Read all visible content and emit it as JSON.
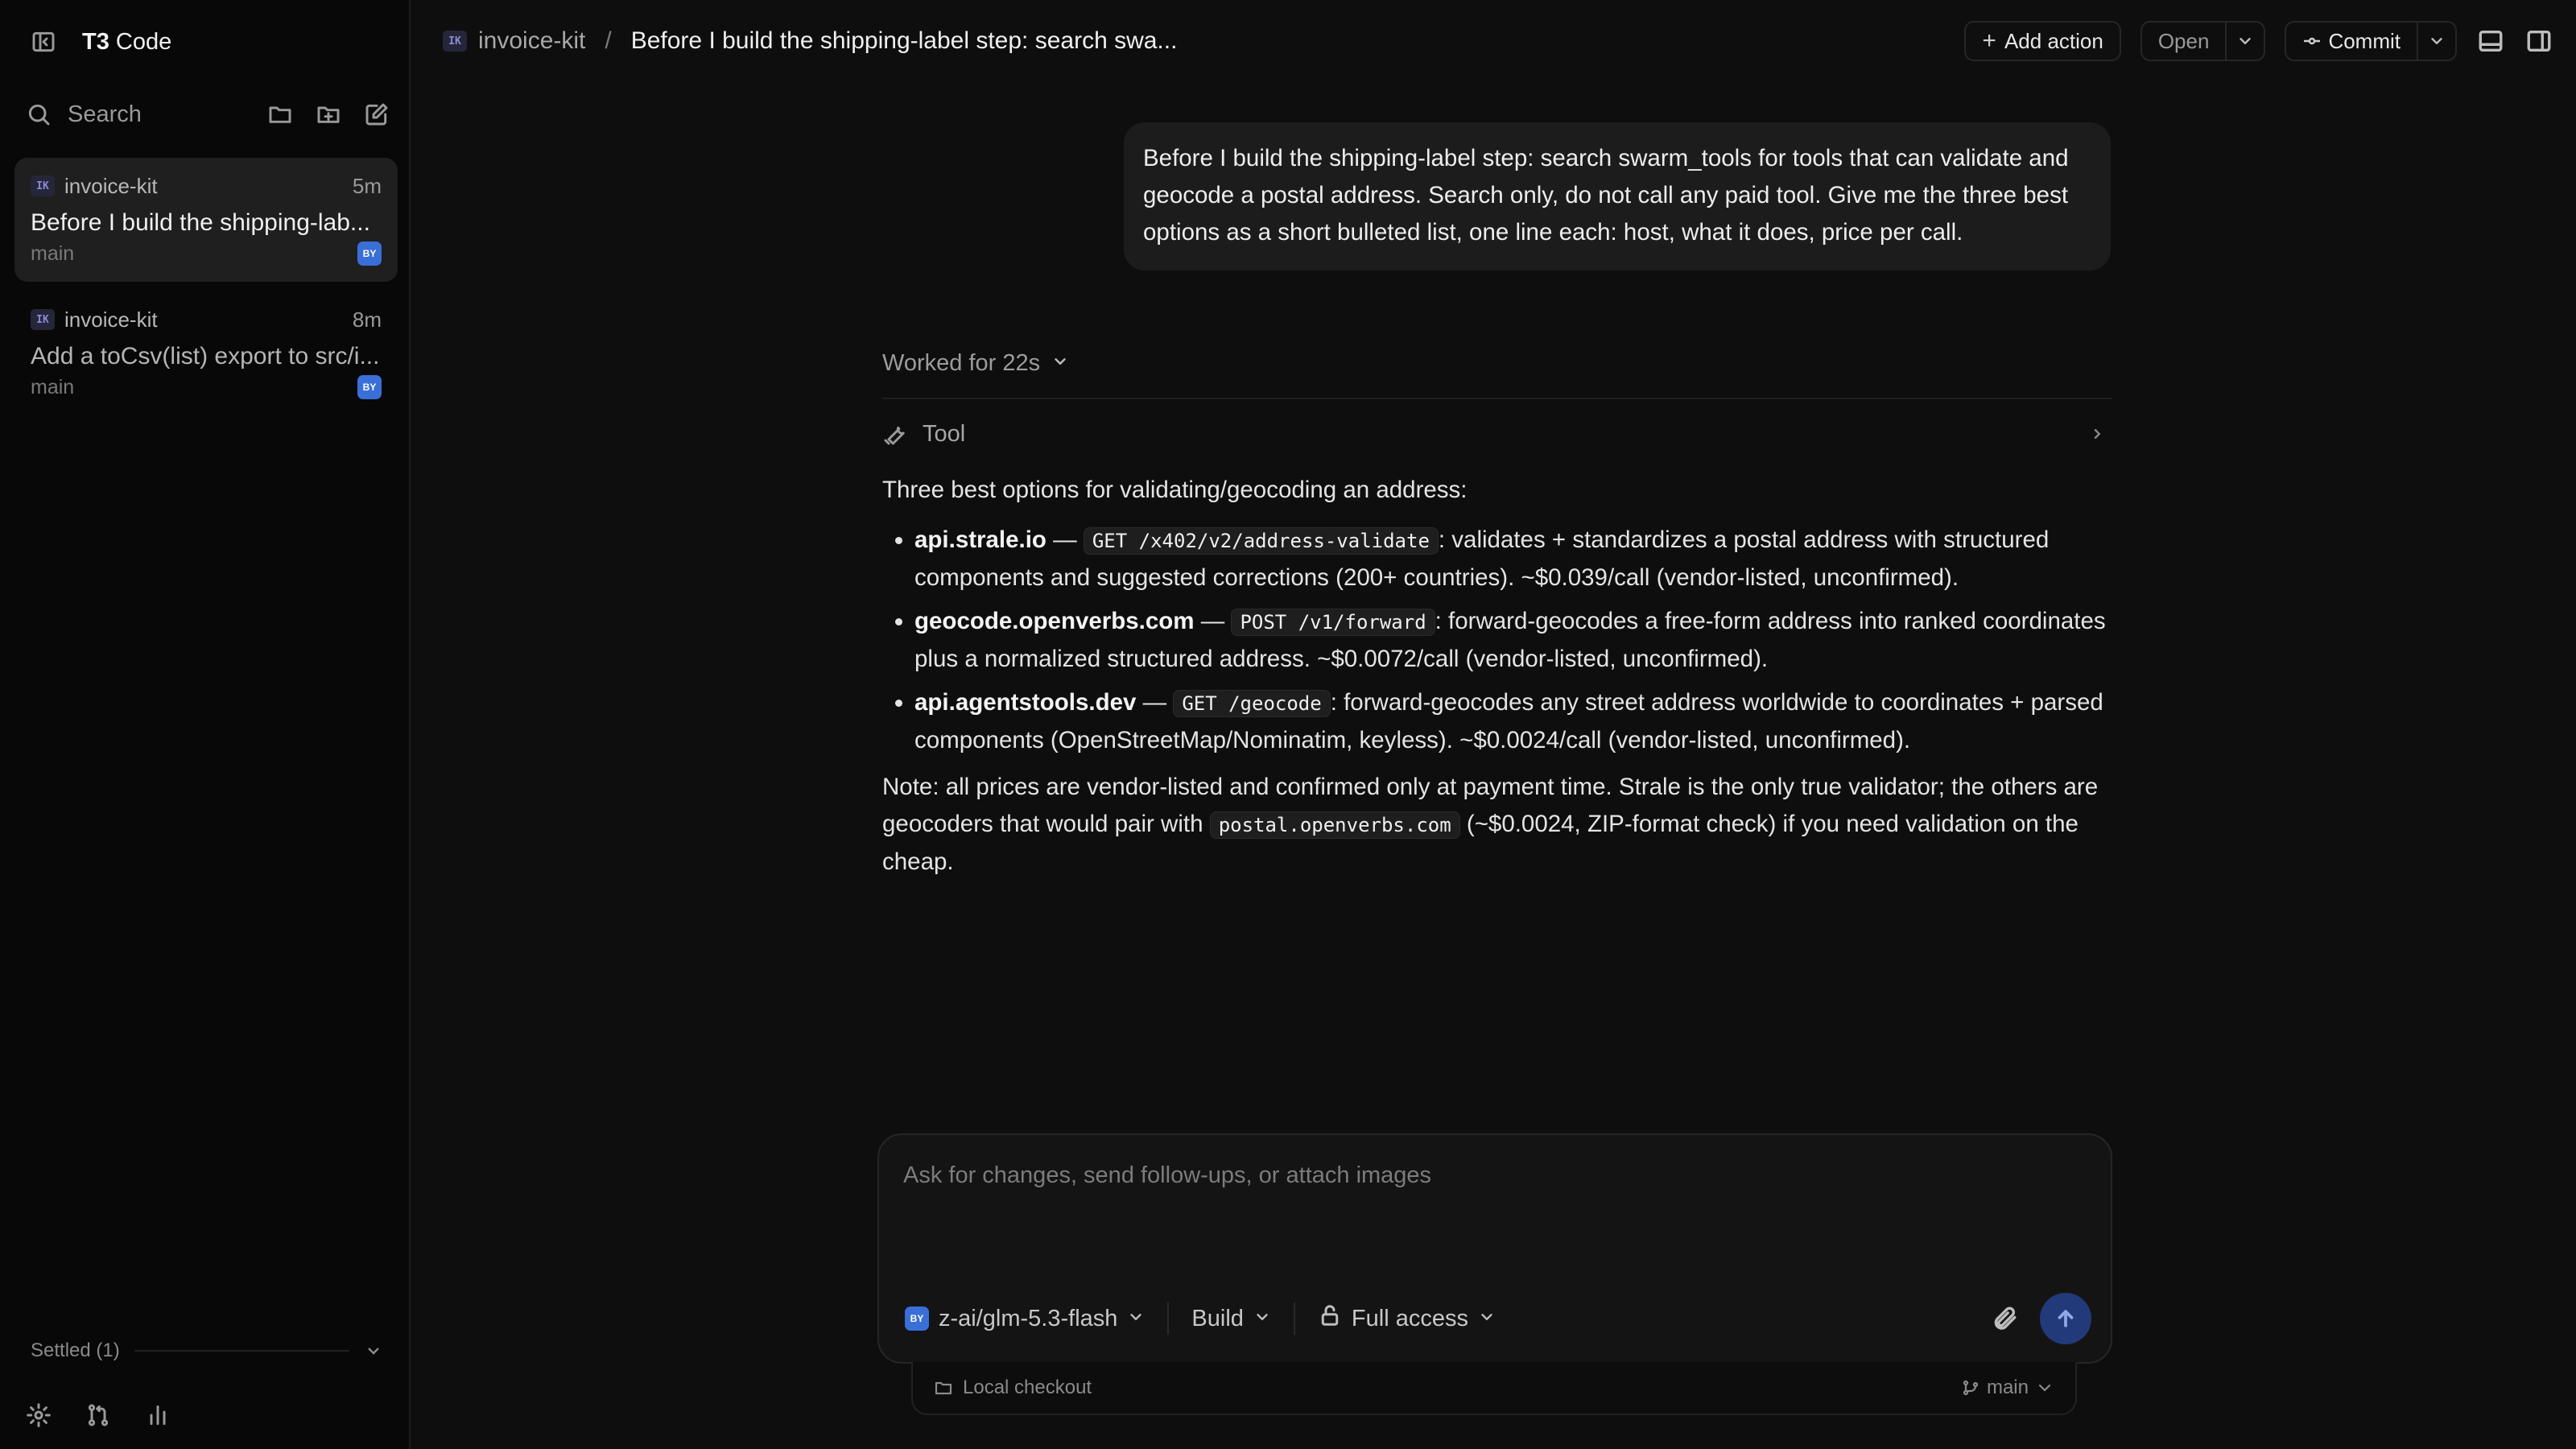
{
  "app": {
    "brand_bold": "T3",
    "brand_rest": " Code"
  },
  "sidebar": {
    "search_label": "Search",
    "threads": [
      {
        "project_badge": "IK",
        "project": "invoice-kit",
        "time": "5m",
        "title": "Before I build the shipping-lab...",
        "branch": "main",
        "model_badge": "BY",
        "active": true
      },
      {
        "project_badge": "IK",
        "project": "invoice-kit",
        "time": "8m",
        "title": "Add a toCsv(list) export to src/i...",
        "branch": "main",
        "model_badge": "BY",
        "active": false
      }
    ],
    "settled_label": "Settled (1)"
  },
  "topbar": {
    "project_badge": "IK",
    "project": "invoice-kit",
    "separator": "/",
    "thread_title": "Before I build the shipping-label step: search swa...",
    "add_action_label": "Add action",
    "open_label": "Open",
    "commit_label": "Commit"
  },
  "conversation": {
    "user_message": "Before I build the shipping-label step: search swarm_tools for tools that can validate and geocode a postal address. Search only, do not call any paid tool. Give me the three best options as a short bulleted list, one line each: host, what it does, price per call.",
    "worked_label": "Worked for 22s",
    "tool_label": "Tool",
    "intro": "Three best options for validating/geocoding an address:",
    "options": [
      {
        "host": "api.strale.io",
        "dash": " — ",
        "endpoint": "GET /x402/v2/address-validate",
        "desc": ": validates + standardizes a postal address with structured components and suggested corrections (200+ countries). ~$0.039/call (vendor-listed, unconfirmed)."
      },
      {
        "host": "geocode.openverbs.com",
        "dash": " — ",
        "endpoint": "POST /v1/forward",
        "desc": ": forward-geocodes a free-form address into ranked coordinates plus a normalized structured address. ~$0.0072/call (vendor-listed, unconfirmed)."
      },
      {
        "host": "api.agentstools.dev",
        "dash": " — ",
        "endpoint": "GET /geocode",
        "desc": ": forward-geocodes any street address worldwide to coordinates + parsed components (OpenStreetMap/Nominatim, keyless). ~$0.0024/call (vendor-listed, unconfirmed)."
      }
    ],
    "note_before": "Note: all prices are vendor-listed and confirmed only at payment time. Strale is the only true validator; the others are geocoders that would pair with ",
    "note_code": "postal.openverbs.com",
    "note_after": " (~$0.0024, ZIP-format check) if you need validation on the cheap."
  },
  "composer": {
    "placeholder": "Ask for changes, send follow-ups, or attach images",
    "model_badge": "BY",
    "model": "z-ai/glm-5.3-flash",
    "mode": "Build",
    "access": "Full access",
    "checkout_label": "Local checkout",
    "branch": "main"
  },
  "colors": {
    "accent": "#3b6fd8",
    "send_button": "#223a7a",
    "background": "#0e0e0e",
    "sidebar": "#080808"
  },
  "icons": [
    "sidebar-toggle-icon",
    "search-icon",
    "folder-icon",
    "folder-plus-icon",
    "compose-icon",
    "settings-icon",
    "git-pull-request-icon",
    "bar-chart-icon",
    "wrench-icon",
    "paperclip-icon",
    "arrow-up-icon",
    "lock-icon",
    "git-branch-icon",
    "panel-bottom-icon",
    "panel-right-icon",
    "commit-icon"
  ]
}
